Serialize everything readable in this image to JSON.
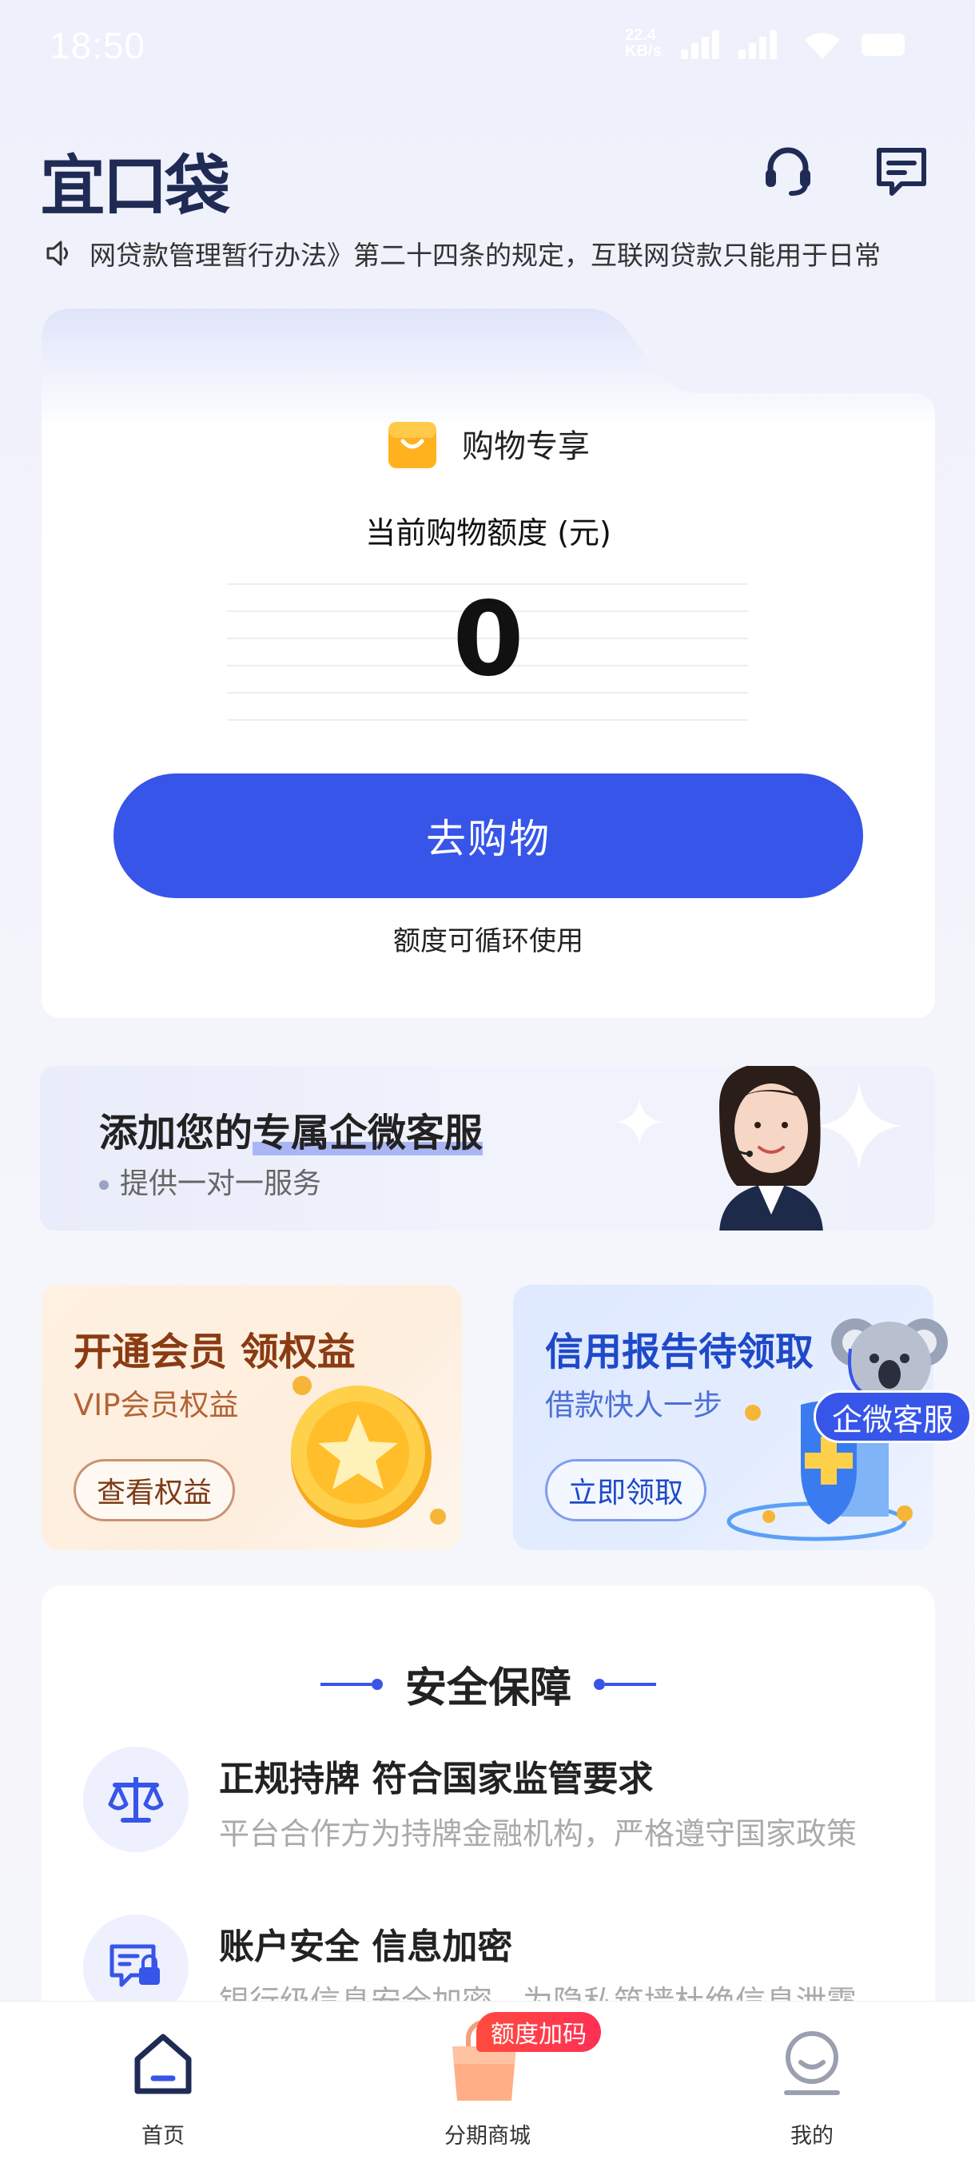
{
  "status_bar": {
    "time": "18:50",
    "net_speed_value": "22.4",
    "net_speed_unit": "KB/s"
  },
  "header": {
    "logo": "宜口袋",
    "icons": [
      "headset-icon",
      "message-icon"
    ]
  },
  "notice": {
    "text": "网贷款管理暂行办法》第二十四条的规定，互联网贷款只能用于日常"
  },
  "main_card": {
    "tag": "购物专享",
    "limit_label": "当前购物额度 (元)",
    "amount": "0",
    "button": "去购物",
    "footnote": "额度可循环使用"
  },
  "service_banner": {
    "title_prefix": "添加您的",
    "title_highlight": "专属企微客服",
    "subtitle": "提供一对一服务"
  },
  "promos": {
    "vip": {
      "title": "开通会员 领权益",
      "subtitle": "VIP会员权益",
      "button": "查看权益"
    },
    "credit": {
      "title": "信用报告待领取",
      "subtitle": "借款快人一步",
      "button": "立即领取"
    }
  },
  "floating_service": {
    "label": "企微客服"
  },
  "security": {
    "heading": "安全保障",
    "items": [
      {
        "title": "正规持牌 符合国家监管要求",
        "desc": "平台合作方为持牌金融机构，严格遵守国家政策"
      },
      {
        "title": "账户安全 信息加密",
        "desc": "银行级信息安全加密，为隐私筑墙杜绝信息泄露"
      }
    ]
  },
  "tabbar": {
    "tabs": [
      {
        "label": "首页",
        "active": true
      },
      {
        "label": "分期商城",
        "active": false
      },
      {
        "label": "我的",
        "active": false
      }
    ],
    "badge": "额度加码"
  },
  "colors": {
    "primary": "#3755e8",
    "logo": "#1f2b54",
    "badge": "#ff3b4a"
  }
}
